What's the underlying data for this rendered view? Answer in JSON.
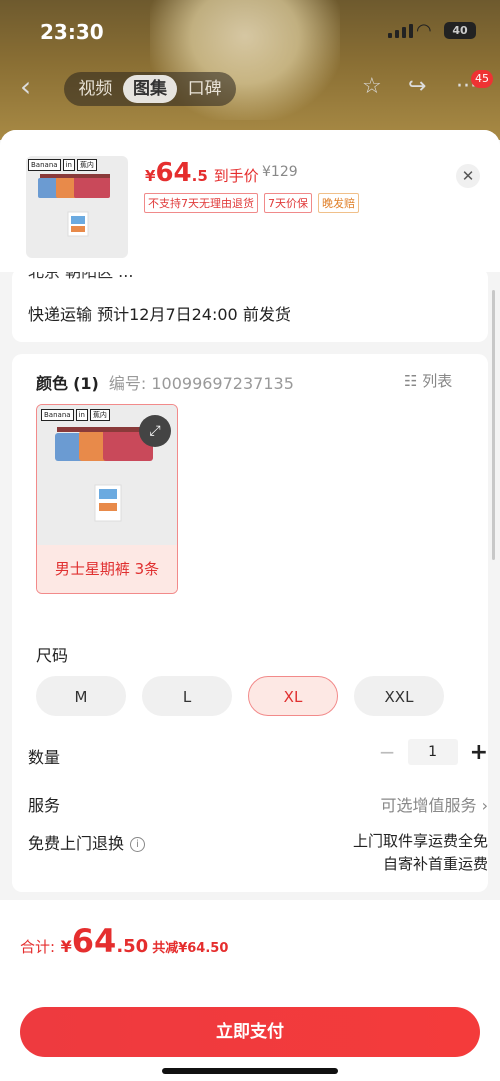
{
  "status": {
    "time": "23:30",
    "battery": "40"
  },
  "nav": {
    "tabs": [
      "视频",
      "图集",
      "口碑"
    ],
    "active_tab": 1,
    "badge_count": "45"
  },
  "product": {
    "price_currency": "¥",
    "price_int": "64",
    "price_dec": ".5",
    "price_label": "到手价",
    "original_price": "¥129",
    "tags": [
      "不支持7天无理由退货",
      "7天价保",
      "晚发赔"
    ],
    "brand_labels": [
      "Banana",
      "in",
      "蕉内"
    ]
  },
  "shipping": {
    "cut_text": "北京 朝阳区 ...",
    "text": "快递运输  预计12月7日24:00 前发货"
  },
  "color": {
    "label": "颜色",
    "count": "(1)",
    "code_label": "编号: 10099697237135",
    "list_button": "列表",
    "option_label": "男士星期裤 3条"
  },
  "size": {
    "label": "尺码",
    "options": [
      "M",
      "L",
      "XL",
      "XXL"
    ],
    "selected": 2
  },
  "quantity": {
    "label": "数量",
    "minus": "−",
    "value": "1",
    "plus": "+"
  },
  "service": {
    "label": "服务",
    "value": "可选增值服务"
  },
  "returns": {
    "label": "免费上门退换",
    "line1": "上门取件享运费全免",
    "line2": "自寄补首重运费"
  },
  "footer": {
    "total_label": "合计:",
    "currency": "¥",
    "total_int": "64",
    "total_dec": ".50",
    "discount": "共减¥64.50",
    "pay_label": "立即支付"
  },
  "colors": {
    "accent": "#e52e2e",
    "selected_bg": "#fde8e4"
  }
}
